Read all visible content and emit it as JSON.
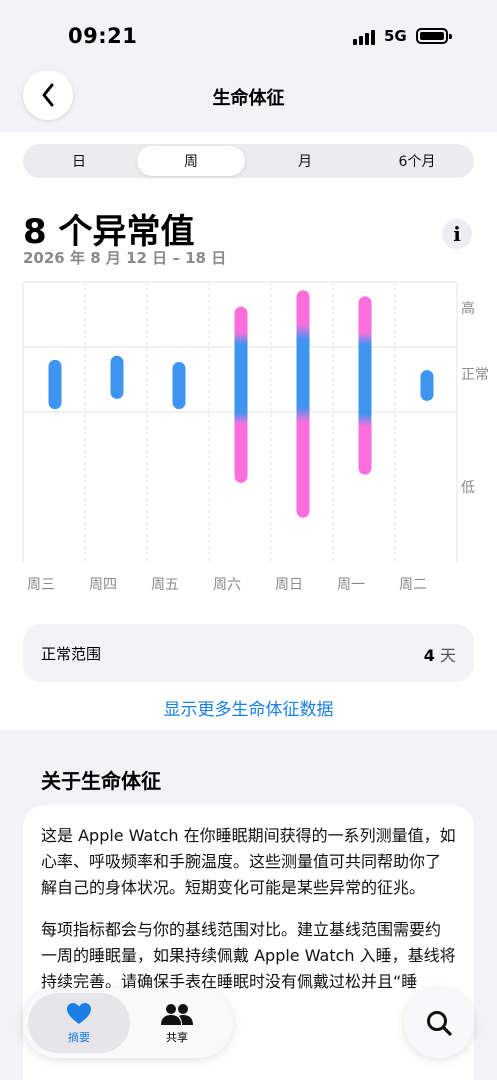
{
  "status": {
    "time": "09:21",
    "network": "5G"
  },
  "nav": {
    "title": "生命体征"
  },
  "segments": [
    "日",
    "周",
    "月",
    "6个月"
  ],
  "summary": {
    "title": "8 个异常值",
    "date_range": "2026 年 8 月 12 日 – 18 日"
  },
  "chart_data": {
    "type": "range-bar",
    "categories": [
      "周三",
      "周四",
      "周五",
      "周六",
      "周日",
      "周一",
      "周二"
    ],
    "y_levels": [
      "高",
      "正常",
      "低"
    ],
    "series": [
      {
        "day": "周三",
        "top": 0.62,
        "bottom": 0.38,
        "abnormal": false
      },
      {
        "day": "周四",
        "top": 0.64,
        "bottom": 0.43,
        "abnormal": false
      },
      {
        "day": "周五",
        "top": 0.61,
        "bottom": 0.38,
        "abnormal": false
      },
      {
        "day": "周六",
        "top": 0.88,
        "bottom": 0.02,
        "abnormal": true,
        "normal_top": 0.72,
        "normal_bottom": 0.34
      },
      {
        "day": "周日",
        "top": 0.96,
        "bottom": -0.15,
        "abnormal": true,
        "normal_top": 0.75,
        "normal_bottom": 0.36
      },
      {
        "day": "周一",
        "top": 0.93,
        "bottom": 0.06,
        "abnormal": true,
        "normal_top": 0.72,
        "normal_bottom": 0.33
      },
      {
        "day": "周二",
        "top": 0.57,
        "bottom": 0.42,
        "abnormal": false
      }
    ],
    "colors": {
      "normal": "#3d95f0",
      "abnormal": "#fb6fdd"
    }
  },
  "normal_range": {
    "label": "正常范围",
    "value": "4",
    "unit": "天"
  },
  "more_link": "显示更多生命体征数据",
  "about": {
    "title": "关于生命体征",
    "paragraph1": "这是 Apple Watch 在你睡眠期间获得的一系列测量值，如心率、呼吸频率和手腕温度。这些测量值可共同帮助你了解自己的身体状况。短期变化可能是某些异常的征兆。",
    "paragraph2": "每项指标都会与你的基线范围对比。建立基线范围需要约一周的睡眠量，如果持续佩戴 Apple Watch 入睡，基线将持续完善。请确保手表在睡眠时没有佩戴过松并且“睡眠”已打开。"
  },
  "tabbar": {
    "summary_label": "摘要",
    "sharing_label": "共享"
  },
  "icons": {
    "back": "chevron-left-icon",
    "info": "info-icon",
    "heart": "heart-icon",
    "people": "people-icon",
    "search": "search-icon"
  }
}
